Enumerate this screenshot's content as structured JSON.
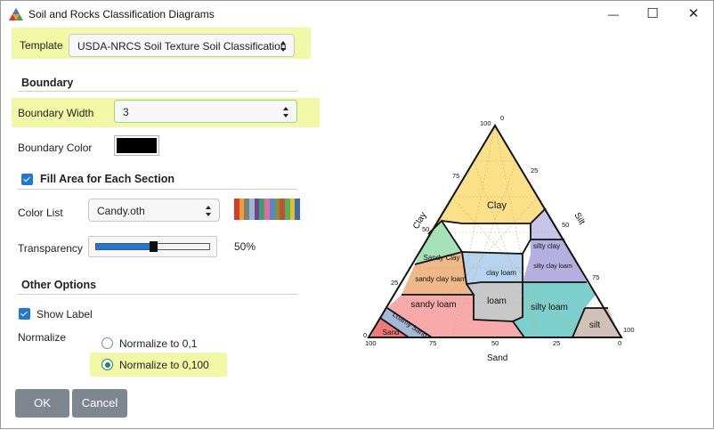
{
  "window": {
    "title": "Soil and Rocks Classification Diagrams",
    "minimize": "—",
    "maximize": "☐",
    "close": "✕"
  },
  "template": {
    "label": "Template",
    "value": "USDA-NRCS Soil Texture Soil Classification"
  },
  "boundary": {
    "section": "Boundary",
    "width_label": "Boundary Width",
    "width_value": "3",
    "color_label": "Boundary Color",
    "color": "#000000"
  },
  "fill": {
    "checkbox_label": "Fill Area for Each Section",
    "checked": true,
    "color_list_label": "Color List",
    "color_list_value": "Candy.oth",
    "palette": [
      "#d63a2c",
      "#e8a02e",
      "#7e7e7e",
      "#9ab8d0",
      "#7a3c8c",
      "#3d9e6e",
      "#e86a9a",
      "#4a8ad6",
      "#8e8e30",
      "#c0503a",
      "#58b058",
      "#e0c030",
      "#3a6ab0"
    ],
    "transparency_label": "Transparency",
    "transparency_value": "50%",
    "transparency_fraction": 0.5
  },
  "other": {
    "section": "Other Options",
    "show_label": "Show Label",
    "show_label_checked": true,
    "normalize_label": "Normalize",
    "options": [
      "Normalize to 0,1",
      "Normalize to 0,100"
    ],
    "selected": "Normalize to 0,100"
  },
  "buttons": {
    "ok": "OK",
    "cancel": "Cancel"
  },
  "diagram": {
    "axes": {
      "left": "Clay",
      "right": "Silt",
      "bottom": "Sand"
    },
    "ticks": {
      "left": [
        "100",
        "75",
        "50",
        "25",
        "0"
      ],
      "right": [
        "0",
        "25",
        "50",
        "75",
        "100"
      ],
      "bottom": [
        "100",
        "75",
        "50",
        "25",
        "0"
      ]
    },
    "regions": [
      {
        "label": "Clay",
        "color": "#fbe08a"
      },
      {
        "label": "silty clay",
        "color": "#c8c4ea"
      },
      {
        "label": "Sandy Clay",
        "color": "#a5e2b8"
      },
      {
        "label": "silty clay loam",
        "color": "#b6b0e2"
      },
      {
        "label": "clay loam",
        "color": "#b6d4ef"
      },
      {
        "label": "sandy clay loam",
        "color": "#f0b888"
      },
      {
        "label": "loam",
        "color": "#c8c8c8"
      },
      {
        "label": "silty loam",
        "color": "#7ccfcc"
      },
      {
        "label": "silt",
        "color": "#d0c2b8"
      },
      {
        "label": "sandy loam",
        "color": "#f8aaaa"
      },
      {
        "label": "Loamy Sand",
        "color": "#a4b8d8"
      },
      {
        "label": "Sand",
        "color": "#ee7a7a"
      }
    ]
  }
}
